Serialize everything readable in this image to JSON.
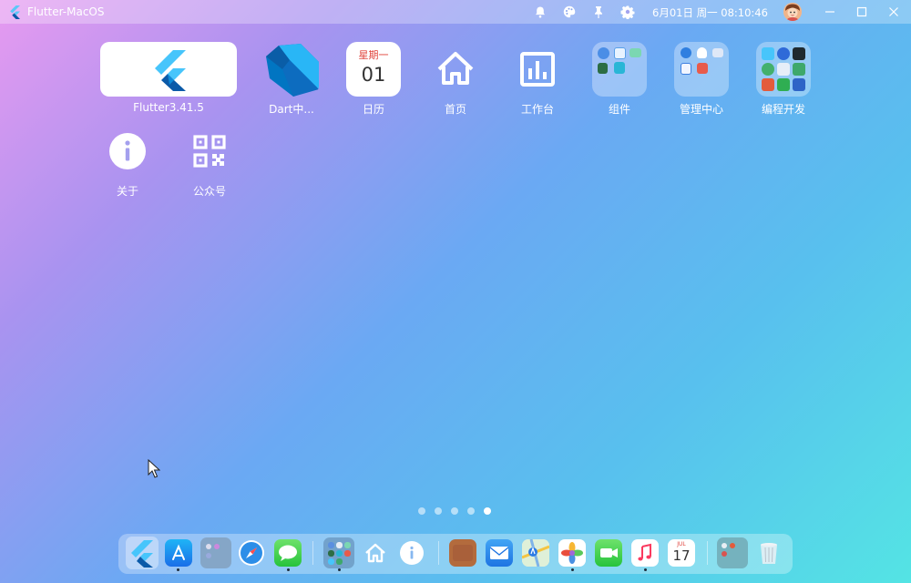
{
  "topbar": {
    "title": "Flutter-MacOS",
    "clock": "6月01日 周一  08:10:46",
    "icons": [
      "bell-icon",
      "palette-icon",
      "pin-icon",
      "gear-icon"
    ],
    "window_controls": [
      "minimize-icon",
      "maximize-icon",
      "close-icon"
    ]
  },
  "desktop": {
    "flutter": "Flutter3.41.5",
    "dart": "Dart中...",
    "calendar": {
      "label": "日历",
      "weekday": "星期一",
      "day": "01"
    },
    "home": "首页",
    "workbench": "工作台",
    "components": "组件",
    "admin": "管理中心",
    "dev": "编程开发",
    "about": "关于",
    "wechat": "公众号"
  },
  "pager": {
    "count": 5,
    "active": 5
  },
  "dock": {
    "items": [
      "flutter",
      "app-store",
      "folder",
      "safari",
      "messages",
      "folder",
      "home",
      "about",
      "notes",
      "mail",
      "maps",
      "photos",
      "facetime",
      "music",
      "calendar",
      "folder",
      "trash"
    ],
    "calendar_month": "JUL",
    "calendar_day": "17"
  },
  "colors": {
    "accent": "#1b6fe0",
    "flutter_blue": "#47c5fb",
    "flutter_dark": "#0b5aa8",
    "dart_blue": "#0175c2"
  }
}
